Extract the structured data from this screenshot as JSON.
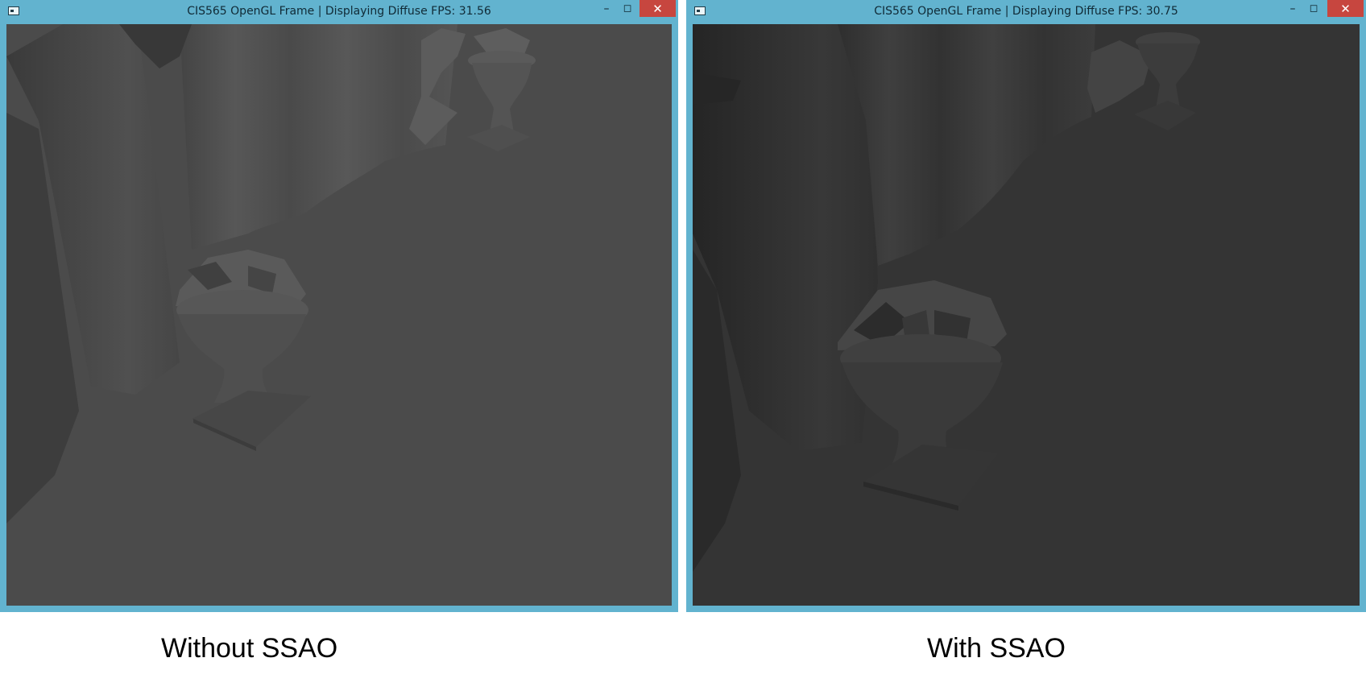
{
  "windows": [
    {
      "title": "CIS565 OpenGL Frame | Displaying Diffuse FPS: 31.56",
      "controls": {
        "minimize": "–",
        "maximize": "◻",
        "close": "✕"
      },
      "caption": "Without SSAO"
    },
    {
      "title": "CIS565 OpenGL Frame | Displaying Diffuse FPS: 30.75",
      "controls": {
        "minimize": "–",
        "maximize": "◻",
        "close": "✕"
      },
      "caption": "With SSAO"
    }
  ],
  "colors": {
    "window_frame": "#62b3cf",
    "close_button": "#c7463f",
    "scene_bg_without_ssao": "#4b4b4b",
    "scene_bg_with_ssao": "#343434"
  },
  "icons": [
    "window-system-icon",
    "minimize-icon",
    "maximize-icon",
    "close-icon"
  ]
}
